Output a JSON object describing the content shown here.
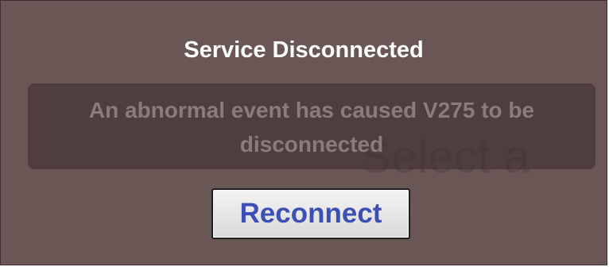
{
  "dialog": {
    "title": "Service Disconnected",
    "message": "An abnormal event has caused V275 to be disconnected",
    "reconnect_label": "Reconnect",
    "background_text": "Select a"
  },
  "colors": {
    "dialog_background": "#6b5656",
    "title_text": "#ffffff",
    "message_text": "#8c7b7b",
    "button_text": "#3b4fb4"
  }
}
